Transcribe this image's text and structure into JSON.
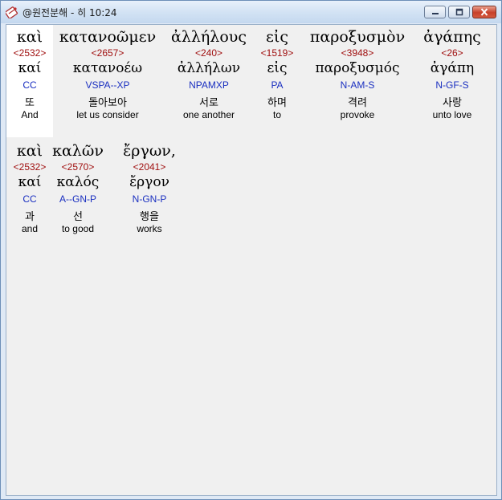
{
  "window": {
    "title": "@원전분해 - 히 10:24"
  },
  "rows": [
    {
      "words": [
        {
          "greek": "καὶ",
          "strong": "<2532>",
          "lemma": "καί",
          "parse": "CC",
          "korean": "또",
          "english": "And"
        },
        {
          "greek": "κατανοῶμεν",
          "strong": "<2657>",
          "lemma": "κατανοέω",
          "parse": "VSPA--XP",
          "korean": "돌아보아",
          "english": "let us consider"
        },
        {
          "greek": "ἀλλήλους",
          "strong": "<240>",
          "lemma": "ἀλλήλων",
          "parse": "NPAMXP",
          "korean": "서로",
          "english": "one another"
        },
        {
          "greek": "εἰς",
          "strong": "<1519>",
          "lemma": "εἰς",
          "parse": "PA",
          "korean": "하며",
          "english": "to"
        },
        {
          "greek": "παροξυσμὸν",
          "strong": "<3948>",
          "lemma": "παροξυσμός",
          "parse": "N-AM-S",
          "korean": "격려",
          "english": "provoke"
        },
        {
          "greek": "ἀγάπης",
          "strong": "<26>",
          "lemma": "ἀγάπη",
          "parse": "N-GF-S",
          "korean": "사랑",
          "english": "unto love"
        }
      ]
    },
    {
      "words": [
        {
          "greek": "καὶ",
          "strong": "<2532>",
          "lemma": "καί",
          "parse": "CC",
          "korean": "과",
          "english": "and"
        },
        {
          "greek": "καλῶν",
          "strong": "<2570>",
          "lemma": "καλός",
          "parse": "A--GN-P",
          "korean": "선",
          "english": "to good"
        },
        {
          "greek": "ἔργων,",
          "strong": "<2041>",
          "lemma": "ἔργον",
          "parse": "N-GN-P",
          "korean": "행을",
          "english": "works"
        }
      ]
    }
  ]
}
